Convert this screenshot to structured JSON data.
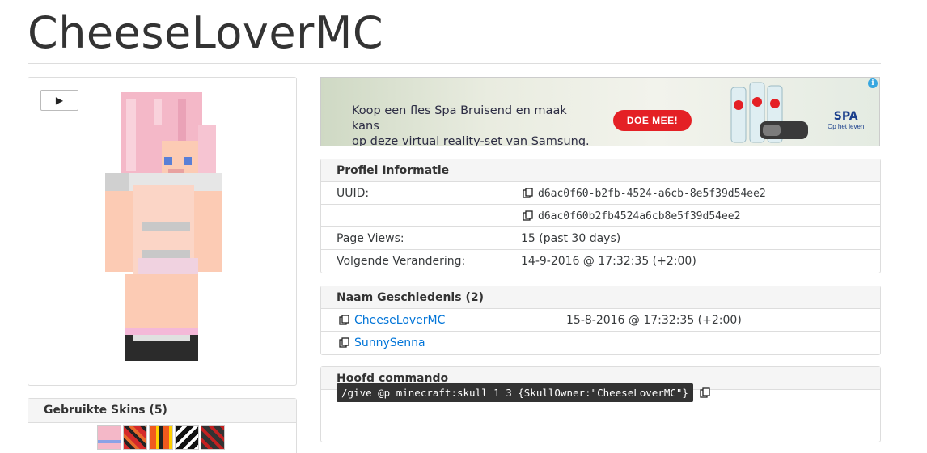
{
  "page": {
    "title": "CheeseLoverMC"
  },
  "skin_viewer": {
    "play_label": "▶"
  },
  "skins": {
    "header": "Gebruikte Skins (5)"
  },
  "ad": {
    "text_line1": "Koop een fles Spa Bruisend en maak kans",
    "text_line2": "op deze virtual reality-set van Samsung.",
    "button": "DOE MEE!",
    "logo": "SPA",
    "logo_tagline": "Op het leven",
    "info": "i"
  },
  "profile": {
    "header": "Profiel Informatie",
    "rows": [
      {
        "label": "UUID:",
        "value": "d6ac0f60-b2fb-4524-a6cb-8e5f39d54ee2"
      },
      {
        "label": "",
        "value": "d6ac0f60b2fb4524a6cb8e5f39d54ee2"
      },
      {
        "label": "Page Views:",
        "value": "15 (past 30 days)"
      },
      {
        "label": "Volgende Verandering:",
        "value": "14-9-2016 @ 17:32:35 (+2:00)"
      }
    ]
  },
  "name_history": {
    "header": "Naam Geschiedenis (2)",
    "rows": [
      {
        "name": "CheeseLoverMC",
        "date": "15-8-2016 @ 17:32:35 (+2:00)"
      },
      {
        "name": "SunnySenna",
        "date": ""
      }
    ]
  },
  "head_command": {
    "header": "Hoofd commando",
    "command": "/give @p minecraft:skull 1 3 {SkullOwner:\"CheeseLoverMC\"}"
  },
  "colors": {
    "link": "#0275d8",
    "ad_button": "#e42025",
    "skin_pink": "#f4b8c8",
    "skin_peach": "#fccbb4"
  },
  "icons": {
    "copy": "copy-icon",
    "play": "play-icon"
  }
}
